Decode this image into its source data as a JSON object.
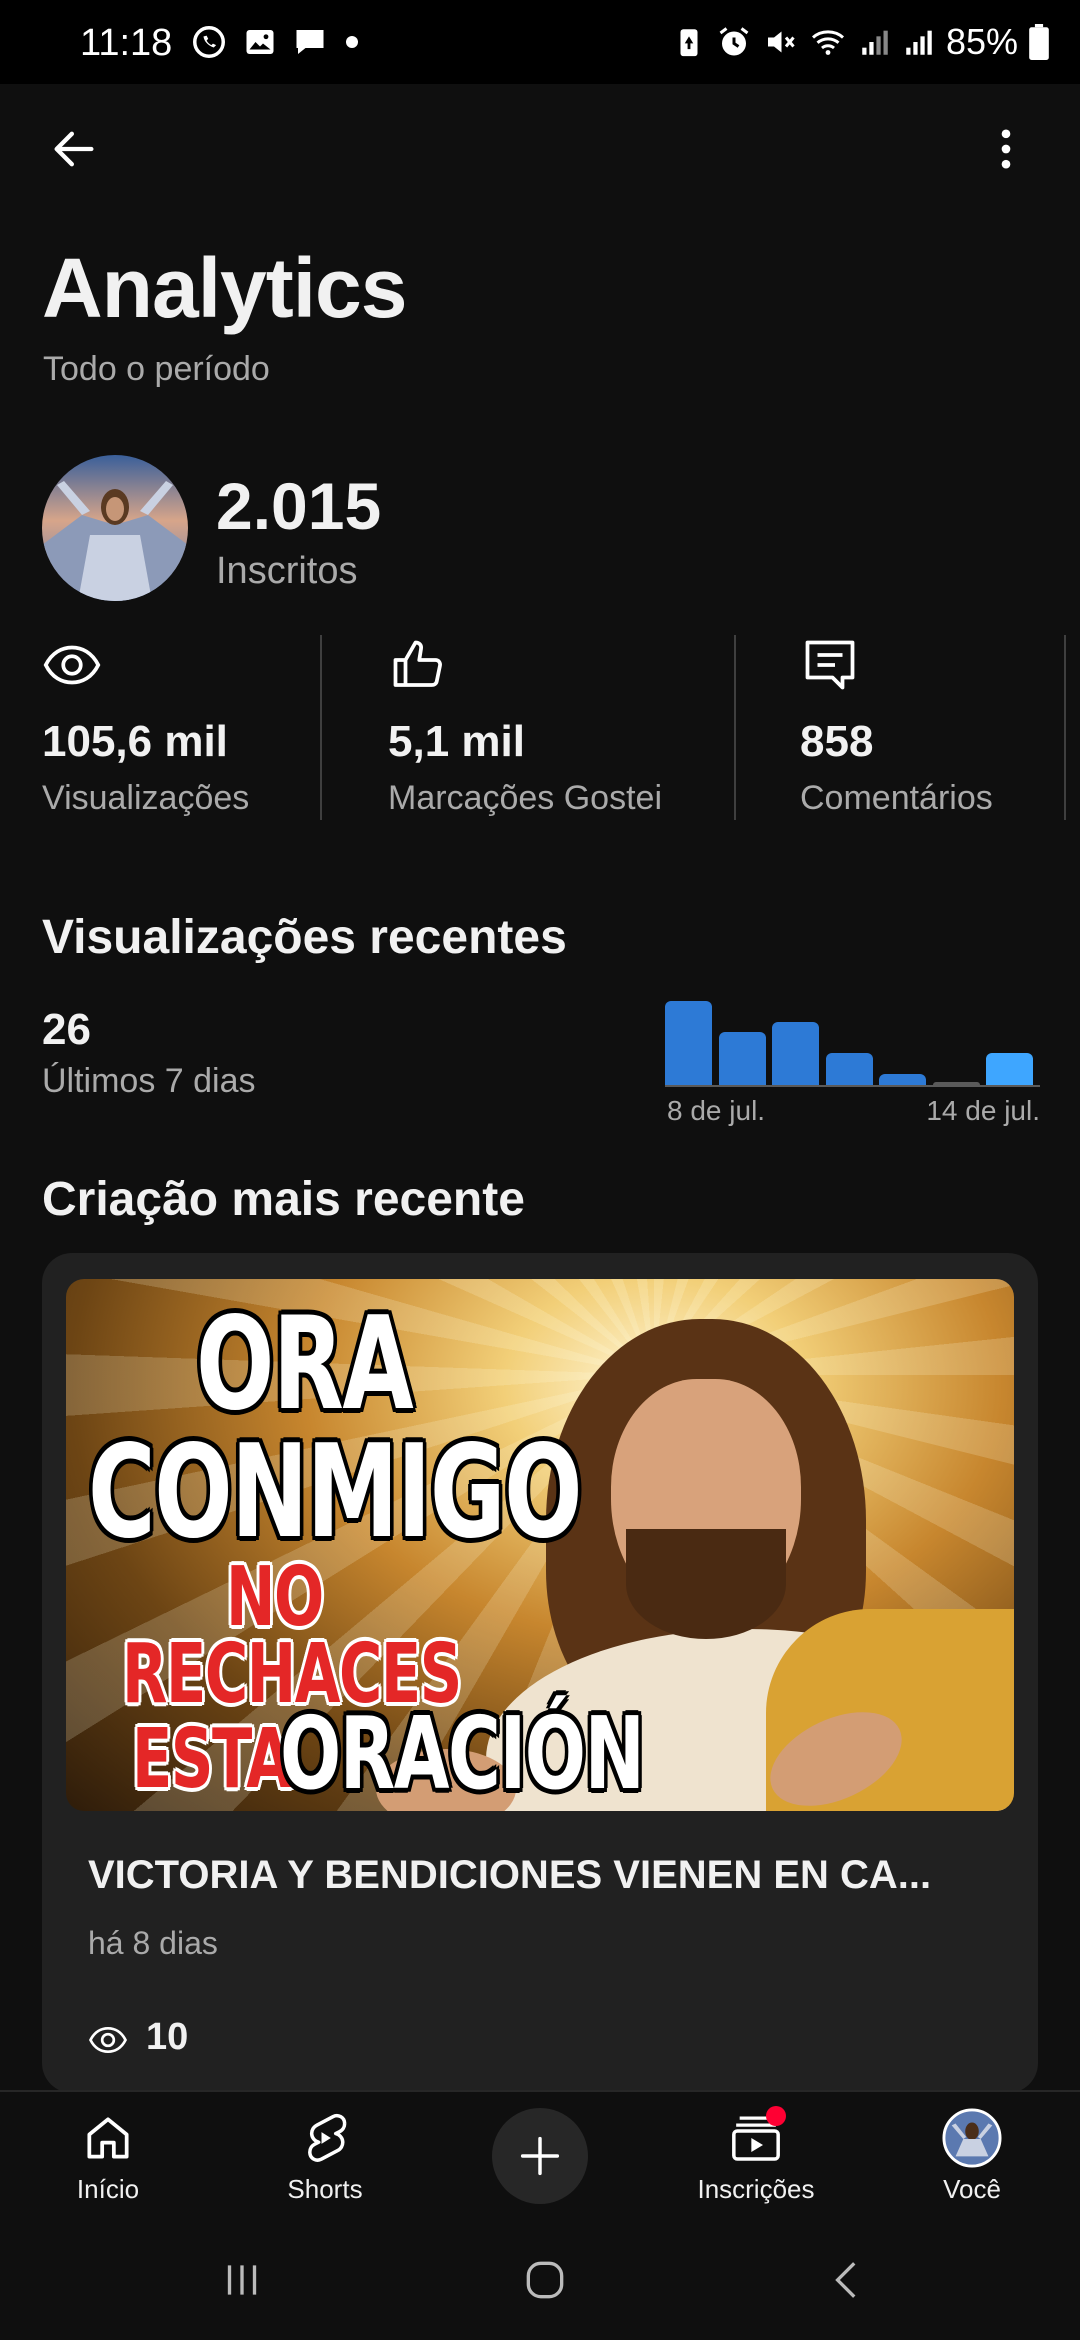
{
  "status_bar": {
    "time": "11:18",
    "battery_percent": "85%",
    "left_icons": [
      "whatsapp-icon",
      "gallery-icon",
      "message-icon",
      "dot-icon"
    ],
    "right_icons": [
      "battery-saver-icon",
      "alarm-icon",
      "mute-icon",
      "wifi-icon",
      "signal-icon",
      "signal-icon",
      "battery-icon"
    ]
  },
  "header": {
    "title": "Analytics",
    "subtitle": "Todo o período"
  },
  "channel": {
    "subscriber_count": "2.015",
    "subscriber_label": "Inscritos"
  },
  "stats": [
    {
      "icon": "eye-icon",
      "value": "105,6 mil",
      "label": "Visualizações"
    },
    {
      "icon": "thumbs-up-icon",
      "value": "5,1 mil",
      "label": "Marcações Gostei"
    },
    {
      "icon": "comment-icon",
      "value": "858",
      "label": "Comentários"
    }
  ],
  "recent_views": {
    "section_title": "Visualizações recentes",
    "count": "26",
    "period_label": "Últimos 7 dias"
  },
  "chart_data": {
    "type": "bar",
    "categories": [
      "8 de jul.",
      "9 de jul.",
      "10 de jul.",
      "11 de jul.",
      "12 de jul.",
      "13 de jul.",
      "14 de jul."
    ],
    "values": [
      8,
      5,
      6,
      3,
      1,
      0,
      3
    ],
    "tick_labels": [
      "8 de jul.",
      "14 de jul."
    ],
    "ylim": [
      0,
      9
    ],
    "colors": [
      "#2d7ad6",
      "#2d7ad6",
      "#2d7ad6",
      "#2d7ad6",
      "#2d7ad6",
      "#2d7ad6",
      "#3ea6ff"
    ],
    "grid": false
  },
  "latest_creation": {
    "section_title": "Criação mais recente",
    "thumbnail_text": {
      "line1": "ORA",
      "line2": "CONMIGO",
      "line3": "NO",
      "line4": "RECHACES",
      "line5a": "ESTA",
      "line5b": "ORACIÓN"
    },
    "video_title": "VICTORIA Y BENDICIONES VIENEN EN CA...",
    "age": "há 8 dias",
    "views": "10"
  },
  "bottom_nav": {
    "items": [
      {
        "icon": "home-icon",
        "label": "Início"
      },
      {
        "icon": "shorts-icon",
        "label": "Shorts"
      },
      {
        "icon": "plus-icon",
        "label": ""
      },
      {
        "icon": "subscriptions-icon",
        "label": "Inscrições"
      },
      {
        "icon": "avatar-icon",
        "label": "Você"
      }
    ],
    "accent": "#ff0033"
  }
}
